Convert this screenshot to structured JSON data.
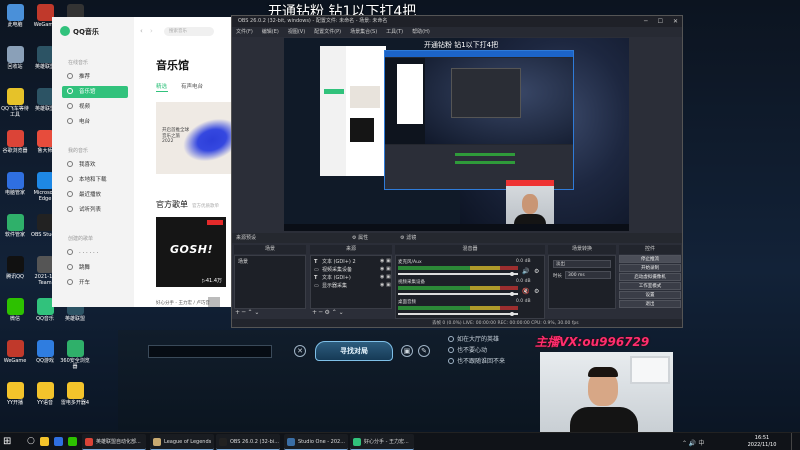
{
  "desktop": {
    "icons": [
      {
        "label": "此电脑",
        "color": "#4a90d9",
        "col": 0,
        "row": 0
      },
      {
        "label": "回收站",
        "color": "#8aa0b8",
        "col": 0,
        "row": 1
      },
      {
        "label": "QQ飞车等待工具",
        "color": "#e6c229",
        "col": 0,
        "row": 2
      },
      {
        "label": "谷歌浏览器",
        "color": "#db4437",
        "col": 0,
        "row": 3
      },
      {
        "label": "电脑管家",
        "color": "#2f6fe0",
        "col": 0,
        "row": 4
      },
      {
        "label": "软件管家",
        "color": "#2fb06a",
        "col": 0,
        "row": 5
      },
      {
        "label": "腾讯QQ",
        "color": "#111111",
        "col": 0,
        "row": 6
      },
      {
        "label": "微信",
        "color": "#2dc100",
        "col": 0,
        "row": 7
      },
      {
        "label": "WeGame",
        "color": "#c0392b",
        "col": 0,
        "row": 8
      },
      {
        "label": "YY开播",
        "color": "#f3c32b",
        "col": 0,
        "row": 9
      },
      {
        "label": "WeGame",
        "color": "#c0392b",
        "col": 1,
        "row": 0
      },
      {
        "label": "英雄联盟",
        "color": "#2c5364",
        "col": 1,
        "row": 1
      },
      {
        "label": "英雄联盟",
        "color": "#2c5364",
        "col": 1,
        "row": 2
      },
      {
        "label": "鲁大师",
        "color": "#e74c3c",
        "col": 1,
        "row": 3
      },
      {
        "label": "Microsoft Edge",
        "color": "#1e88e5",
        "col": 1,
        "row": 4
      },
      {
        "label": "OBS Studio",
        "color": "#222222",
        "col": 1,
        "row": 5
      },
      {
        "label": "2021-11 Team",
        "color": "#555555",
        "col": 1,
        "row": 6
      },
      {
        "label": "QQ音乐",
        "color": "#31c27c",
        "col": 1,
        "row": 7
      },
      {
        "label": "QQ游戏",
        "color": "#2f7de0",
        "col": 1,
        "row": 8
      },
      {
        "label": "YY语音",
        "color": "#f3c32b",
        "col": 1,
        "row": 9
      },
      {
        "label": "剪映专业版",
        "color": "#333333",
        "col": 2,
        "row": 0
      },
      {
        "label": "英雄联盟",
        "color": "#2c5364",
        "col": 2,
        "row": 7
      },
      {
        "label": "360安全浏览器",
        "color": "#2fb06a",
        "col": 2,
        "row": 8
      },
      {
        "label": "雷电多开器4",
        "color": "#f3c32b",
        "col": 2,
        "row": 9
      }
    ],
    "overlay_text": "开通钻粉 钻1以下打4把"
  },
  "qq_music": {
    "logo_text": "QQ音乐",
    "sections": [
      {
        "title": "在线音乐",
        "items": [
          {
            "label": "推荐",
            "icon": "home-icon",
            "active": false
          },
          {
            "label": "音乐馆",
            "icon": "music-note-icon",
            "active": true
          },
          {
            "label": "视频",
            "icon": "video-icon",
            "active": false
          },
          {
            "label": "电台",
            "icon": "radio-icon",
            "active": false
          }
        ]
      },
      {
        "title": "我的音乐",
        "items": [
          {
            "label": "我喜欢",
            "icon": "heart-icon",
            "active": false
          },
          {
            "label": "本地和下载",
            "icon": "download-icon",
            "active": false
          },
          {
            "label": "最近播放",
            "icon": "clock-icon",
            "active": false
          },
          {
            "label": "试听列表",
            "icon": "list-icon",
            "active": false
          }
        ]
      },
      {
        "title": "创建的歌单",
        "items": [
          {
            "label": "· · · · · ·",
            "icon": "dots-icon",
            "active": false
          },
          {
            "label": "跳舞",
            "icon": "playlist-icon",
            "active": false
          },
          {
            "label": "开车",
            "icon": "playlist-icon",
            "active": false
          }
        ]
      }
    ],
    "search_placeholder": "搜索音乐",
    "page_title": "音乐馆",
    "tabs": [
      {
        "label": "精选",
        "active": true
      },
      {
        "label": "有声电台",
        "active": false
      }
    ],
    "banner_text": "开启首推全球音乐之旅 2022",
    "section_title": "官方歌单",
    "section_sub": "官方优质歌单",
    "cover_text": "GOSH!",
    "cover_plays": "▷41.4万",
    "now_playing": "好心分手 - 王力宏 / 卢巧音"
  },
  "obs": {
    "title": "OBS 26.0.2 (32-bit, windows) - 配置文件: 未命名 - 场景: 未命名",
    "window_controls": [
      "─",
      "☐",
      "✕"
    ],
    "menu": [
      "文件(F)",
      "编辑(E)",
      "视图(V)",
      "配置文件(P)",
      "场景集合(S)",
      "工具(T)",
      "帮助(H)"
    ],
    "preview_caption": "开通钻粉 钻1以下打4把",
    "scene_bar": [
      "来源预设",
      "属性",
      "滤镜"
    ],
    "panels": {
      "scenes_title": "场景",
      "sources_title": "来源",
      "mixer_title": "混音器",
      "transitions_title": "场景转换",
      "controls_title": "控件"
    },
    "scenes": [
      "场景"
    ],
    "sources": [
      {
        "type": "T",
        "label": "文本 (GDI+) 2"
      },
      {
        "type": "▭",
        "label": "视频采集设备"
      },
      {
        "type": "T",
        "label": "文本 (GDI+)"
      },
      {
        "type": "▭",
        "label": "显示器采集"
      }
    ],
    "list_buttons": "+ ─ ⌃ ⌄",
    "source_buttons": "+ ─ ⚙ ⌃ ⌄",
    "mixer": [
      {
        "name": "麦克风/Aux",
        "db": "0.0 dB",
        "volume": 0.95,
        "muted": false
      },
      {
        "name": "视频采集设备",
        "db": "0.0 dB",
        "volume": 0.95,
        "muted": true
      },
      {
        "name": "桌面音频",
        "db": "0.0 dB",
        "volume": 0.95,
        "muted": false
      }
    ],
    "transition_type": "淡出",
    "duration_label": "时长",
    "duration_value": "300 ms",
    "controls": [
      "停止推流",
      "开始录制",
      "启动虚拟摄像机",
      "工作室模式",
      "设置",
      "退出"
    ],
    "status": "丢帧 0 (0.0%)    LIVE: 00:00:00    REC: 00:00:00    CPU: 0.9%, 30.00 fps"
  },
  "game": {
    "find_label": "寻找对局",
    "options": [
      "如在大厅的英雄",
      "也不要心动",
      "也不跟随谁回不来"
    ]
  },
  "webcam": {
    "watermark": "主播VX:ou996729"
  },
  "taskbar": {
    "start": "⊞",
    "search": "○",
    "open_apps": [
      {
        "label": "英雄联盟自动化部...",
        "color": "#db4437"
      },
      {
        "label": "League of Legends",
        "color": "#c9aa71"
      },
      {
        "label": "OBS 26.0.2 (32-bi...",
        "color": "#222222"
      },
      {
        "label": "Studio One - 202...",
        "color": "#3a6ea5"
      },
      {
        "label": "好心分手 - 王力宏...",
        "color": "#31c27c"
      }
    ],
    "tray_icons": "⌃ 🔊 中",
    "time": "16:51",
    "date": "2022/11/10"
  }
}
